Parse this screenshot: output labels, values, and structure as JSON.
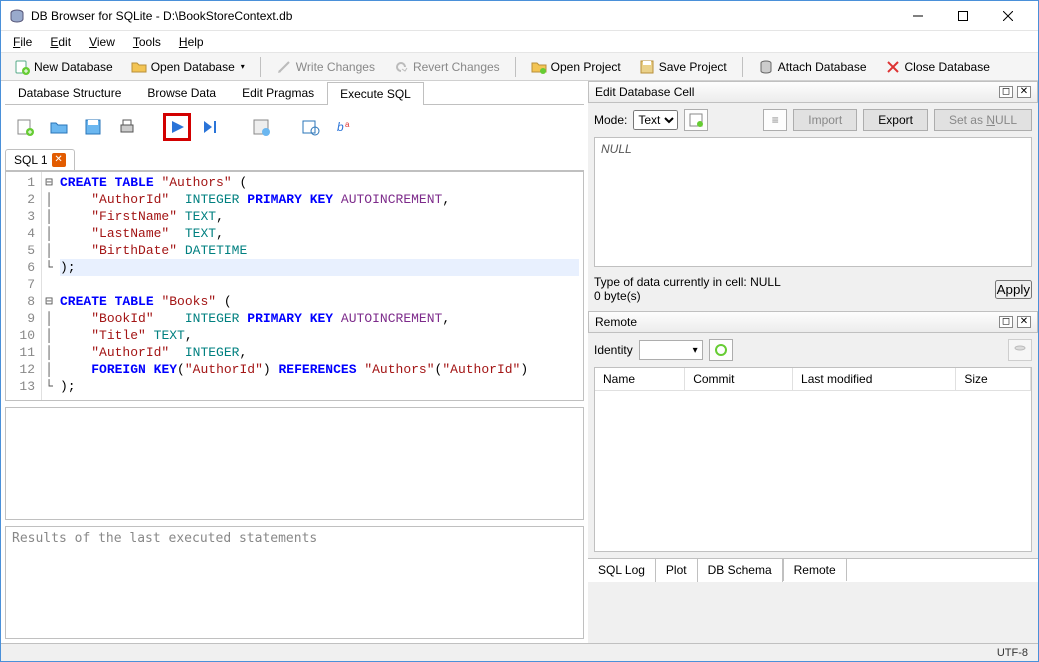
{
  "window": {
    "title": "DB Browser for SQLite - D:\\BookStoreContext.db"
  },
  "menus": {
    "file": "File",
    "edit": "Edit",
    "view": "View",
    "tools": "Tools",
    "help": "Help"
  },
  "toolbar": {
    "new_db": "New Database",
    "open_db": "Open Database",
    "write_changes": "Write Changes",
    "revert_changes": "Revert Changes",
    "open_project": "Open Project",
    "save_project": "Save Project",
    "attach_db": "Attach Database",
    "close_db": "Close Database"
  },
  "tabs": {
    "structure": "Database Structure",
    "browse": "Browse Data",
    "pragmas": "Edit Pragmas",
    "execute": "Execute SQL"
  },
  "sql_tab": {
    "label": "SQL 1"
  },
  "editor": {
    "lines": [
      "1",
      "2",
      "3",
      "4",
      "5",
      "6",
      "7",
      "8",
      "9",
      "10",
      "11",
      "12",
      "13"
    ]
  },
  "results_placeholder": "Results of the last executed statements",
  "edit_cell": {
    "title": "Edit Database Cell",
    "mode_label": "Mode:",
    "mode_value": "Text",
    "import": "Import",
    "export": "Export",
    "set_null": "Set as NULL",
    "null_text": "NULL",
    "type_info": "Type of data currently in cell: NULL",
    "size_info": "0 byte(s)",
    "apply": "Apply"
  },
  "remote": {
    "title": "Remote",
    "identity_label": "Identity",
    "columns": {
      "name": "Name",
      "commit": "Commit",
      "last_modified": "Last modified",
      "size": "Size"
    }
  },
  "bottom_tabs": {
    "sql_log": "SQL Log",
    "plot": "Plot",
    "db_schema": "DB Schema",
    "remote": "Remote"
  },
  "status": {
    "encoding": "UTF-8"
  },
  "sql_source": "CREATE TABLE \"Authors\" (\n    \"AuthorId\"  INTEGER PRIMARY KEY AUTOINCREMENT,\n    \"FirstName\" TEXT,\n    \"LastName\"  TEXT,\n    \"BirthDate\" DATETIME\n);\n\nCREATE TABLE \"Books\" (\n    \"BookId\"    INTEGER PRIMARY KEY AUTOINCREMENT,\n    \"Title\" TEXT,\n    \"AuthorId\"  INTEGER,\n    FOREIGN KEY(\"AuthorId\") REFERENCES \"Authors\"(\"AuthorId\")\n);"
}
